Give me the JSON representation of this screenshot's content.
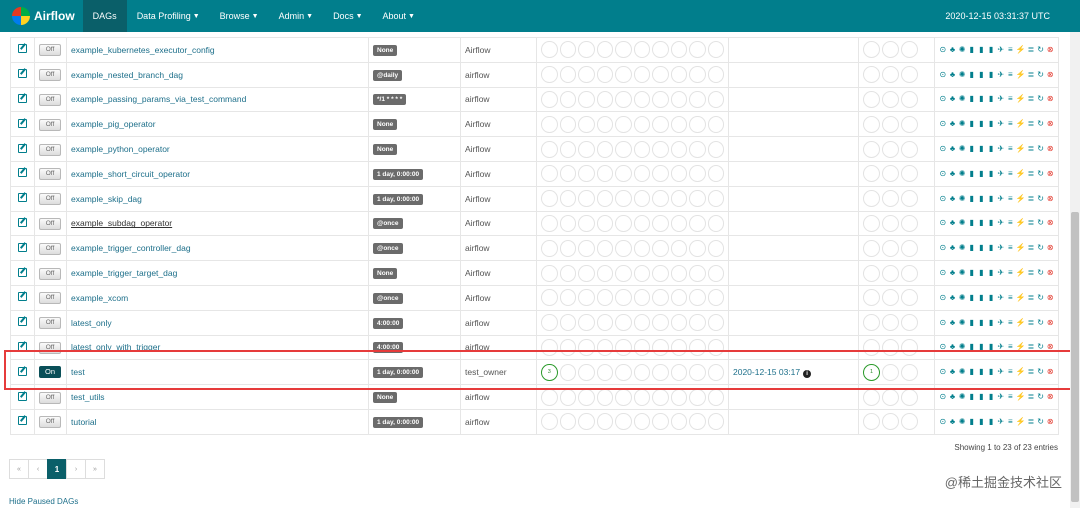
{
  "navbar": {
    "brand": "Airflow",
    "items": [
      {
        "label": "DAGs",
        "active": true,
        "dropdown": false
      },
      {
        "label": "Data Profiling",
        "active": false,
        "dropdown": true
      },
      {
        "label": "Browse",
        "active": false,
        "dropdown": true
      },
      {
        "label": "Admin",
        "active": false,
        "dropdown": true
      },
      {
        "label": "Docs",
        "active": false,
        "dropdown": true
      },
      {
        "label": "About",
        "active": false,
        "dropdown": true
      }
    ],
    "time": "2020-12-15 03:31:37 UTC"
  },
  "dags": [
    {
      "name": "example_kubernetes_executor_config",
      "toggle": "Off",
      "schedule": "None",
      "owner": "Airflow",
      "runs": [],
      "last_run": "",
      "recent": []
    },
    {
      "name": "example_nested_branch_dag",
      "toggle": "Off",
      "schedule": "@daily",
      "owner": "airflow",
      "runs": [],
      "last_run": "",
      "recent": []
    },
    {
      "name": "example_passing_params_via_test_command",
      "toggle": "Off",
      "schedule": "*/1 * * * *",
      "owner": "airflow",
      "runs": [],
      "last_run": "",
      "recent": []
    },
    {
      "name": "example_pig_operator",
      "toggle": "Off",
      "schedule": "None",
      "owner": "Airflow",
      "runs": [],
      "last_run": "",
      "recent": []
    },
    {
      "name": "example_python_operator",
      "toggle": "Off",
      "schedule": "None",
      "owner": "Airflow",
      "runs": [],
      "last_run": "",
      "recent": []
    },
    {
      "name": "example_short_circuit_operator",
      "toggle": "Off",
      "schedule": "1 day, 0:00:00",
      "owner": "Airflow",
      "runs": [],
      "last_run": "",
      "recent": []
    },
    {
      "name": "example_skip_dag",
      "toggle": "Off",
      "schedule": "1 day, 0:00:00",
      "owner": "Airflow",
      "runs": [],
      "last_run": "",
      "recent": []
    },
    {
      "name": "example_subdag_operator",
      "toggle": "Off",
      "schedule": "@once",
      "owner": "Airflow",
      "runs": [],
      "last_run": "",
      "recent": [],
      "underline": true
    },
    {
      "name": "example_trigger_controller_dag",
      "toggle": "Off",
      "schedule": "@once",
      "owner": "airflow",
      "runs": [],
      "last_run": "",
      "recent": []
    },
    {
      "name": "example_trigger_target_dag",
      "toggle": "Off",
      "schedule": "None",
      "owner": "Airflow",
      "runs": [],
      "last_run": "",
      "recent": []
    },
    {
      "name": "example_xcom",
      "toggle": "Off",
      "schedule": "@once",
      "owner": "Airflow",
      "runs": [],
      "last_run": "",
      "recent": []
    },
    {
      "name": "latest_only",
      "toggle": "Off",
      "schedule": "4:00:00",
      "owner": "airflow",
      "runs": [],
      "last_run": "",
      "recent": []
    },
    {
      "name": "latest_only_with_trigger",
      "toggle": "Off",
      "schedule": "4:00:00",
      "owner": "airflow",
      "runs": [],
      "last_run": "",
      "recent": []
    },
    {
      "name": "test",
      "toggle": "On",
      "schedule": "1 day, 0:00:00",
      "owner": "test_owner",
      "runs": [
        "3"
      ],
      "last_run": "2020-12-15 03:17",
      "recent": [
        "1"
      ],
      "on": true
    },
    {
      "name": "test_utils",
      "toggle": "Off",
      "schedule": "None",
      "owner": "airflow",
      "runs": [],
      "last_run": "",
      "recent": []
    },
    {
      "name": "tutorial",
      "toggle": "Off",
      "schedule": "1 day, 0:00:00",
      "owner": "airflow",
      "runs": [],
      "last_run": "",
      "recent": []
    }
  ],
  "link_icons": [
    "trigger-dag-icon",
    "tree-view-icon",
    "graph-view-icon",
    "duration-icon",
    "tries-icon",
    "landing-times-icon",
    "gantt-icon",
    "code-view-icon",
    "logs-icon",
    "refresh-icon",
    "delete-icon"
  ],
  "link_glyphs": [
    "⊙",
    "♣",
    "✺",
    "▮",
    "▮",
    "▮",
    "✈",
    "≡",
    "⚡",
    "≣",
    "↻",
    "⊗"
  ],
  "footer": {
    "entries": "Showing 1 to 23 of 23 entries",
    "pager": [
      "«",
      "‹",
      "1",
      "›",
      "»"
    ],
    "hide_paused": "Hide Paused DAGs"
  },
  "watermark": "@稀土掘金技术社区",
  "colors": {
    "navbar": "#017e8c",
    "active_nav": "#0a5f69",
    "success": "#2a9a2a",
    "delete": "#e2362b",
    "highlight": "#e63b3b"
  }
}
